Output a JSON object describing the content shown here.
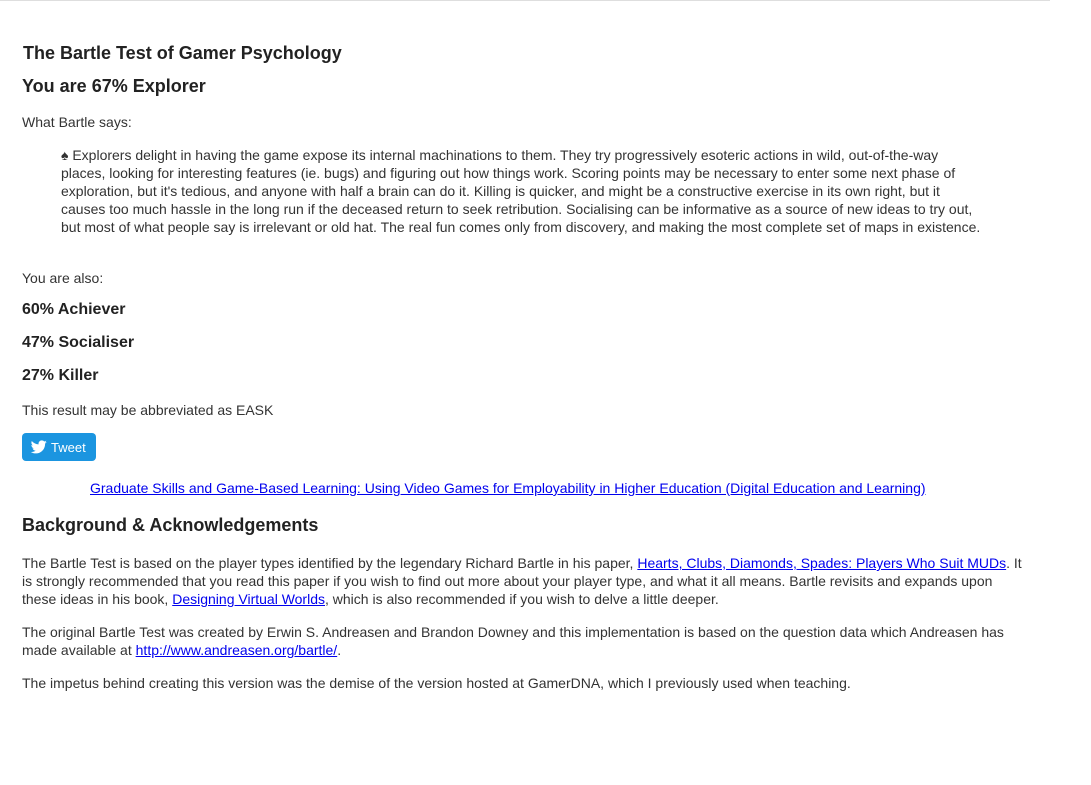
{
  "page": {
    "site_title": "The Bartle Test of Gamer Psychology",
    "result_title": "You are 67% Explorer",
    "what_bartle_says": "What Bartle says:",
    "quote_symbol": "♠",
    "quote_text": "Explorers delight in having the game expose its internal machinations to them. They try progressively esoteric actions in wild, out-of-the-way places, looking for interesting features (ie. bugs) and figuring out how things work. Scoring points may be necessary to enter some next phase of exploration, but it's tedious, and anyone with half a brain can do it. Killing is quicker, and might be a constructive exercise in its own right, but it causes too much hassle in the long run if the deceased return to seek retribution. Socialising can be informative as a source of new ideas to try out, but most of what people say is irrelevant or old hat. The real fun comes only from discovery, and making the most complete set of maps in existence.",
    "you_are_also": "You are also:",
    "also": [
      "60% Achiever",
      "47% Socialiser",
      "27% Killer"
    ],
    "abbreviation": "This result may be abbreviated as EASK",
    "tweet_label": "Tweet",
    "tweet_icon": "twitter-bird-icon",
    "tweet_color": "#1b95e0",
    "book_link": "Graduate Skills and Game-Based Learning: Using Video Games for Employability in Higher Education (Digital Education and Learning)",
    "background_title": "Background & Acknowledgements",
    "para1": {
      "before": "The Bartle Test is based on the player types identified by the legendary Richard Bartle in his paper, ",
      "link1": "Hearts, Clubs, Diamonds, Spades: Players Who Suit MUDs",
      "middle": ". It is strongly recommended that you read this paper if you wish to find out more about your player type, and what it all means. Bartle revisits and expands upon these ideas in his book, ",
      "link2": "Designing Virtual Worlds",
      "after": ", which is also recommended if you wish to delve a little deeper."
    },
    "para2": {
      "before": "The original Bartle Test was created by Erwin S. Andreasen and Brandon Downey and this implementation is based on the question data which Andreasen has made available at ",
      "link": "http://www.andreasen.org/bartle/",
      "after": "."
    },
    "para3": "The impetus behind creating this version was the demise of the version hosted at GamerDNA, which I previously used when teaching.",
    "link_color": "#0000ee"
  }
}
